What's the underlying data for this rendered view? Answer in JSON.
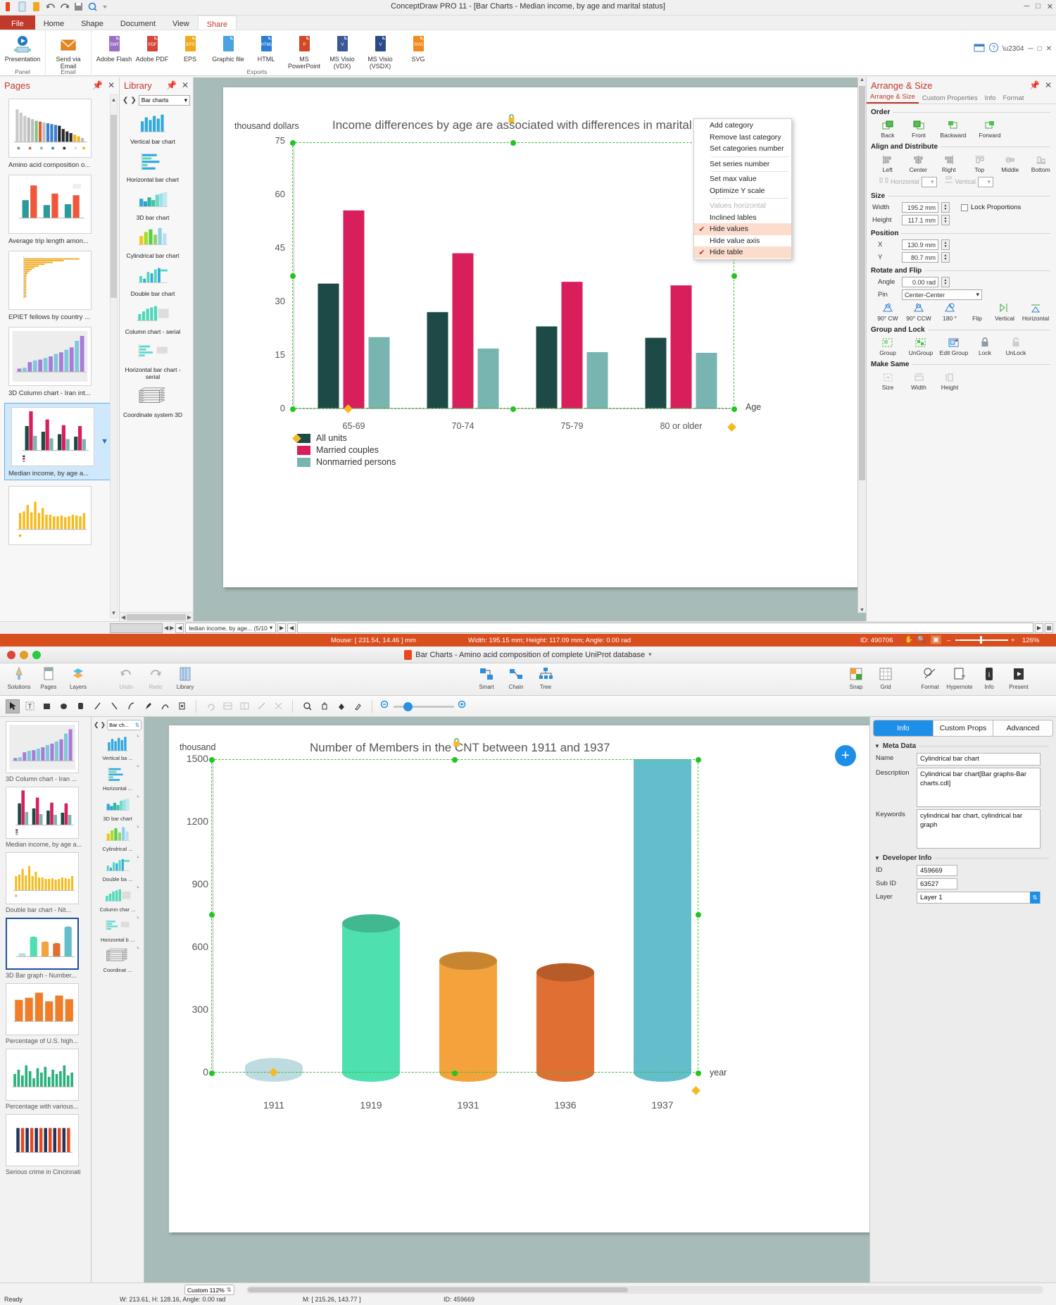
{
  "top_window": {
    "title": "ConceptDraw PRO 11 - [Bar Charts - Median income, by age and marital status]",
    "window_buttons": {
      "minimize": "─",
      "maximize": "□",
      "close": "✕"
    },
    "quick_access": [
      "new-doc-icon",
      "open-icon",
      "save-icon",
      "undo-icon",
      "redo-icon",
      "save2-icon",
      "preview-icon",
      "qat-dropdown-icon"
    ],
    "ribbon_tabs": [
      {
        "label": "File",
        "id": "file"
      },
      {
        "label": "Home",
        "id": "home"
      },
      {
        "label": "Shape",
        "id": "shape"
      },
      {
        "label": "Document",
        "id": "document"
      },
      {
        "label": "View",
        "id": "view"
      },
      {
        "label": "Share",
        "id": "share",
        "active": true
      }
    ],
    "ribbon_groups": [
      {
        "name": "Panel",
        "commands": [
          {
            "label": "Presentation",
            "icon": "presentation-icon",
            "color": "#1f7bbf"
          }
        ]
      },
      {
        "name": "Email",
        "commands": [
          {
            "label": "Send via Email",
            "icon": "email-icon",
            "color": "#e8851f"
          }
        ]
      },
      {
        "name": "Exports",
        "commands": [
          {
            "label": "Adobe Flash",
            "icon": "swf-icon",
            "color": "#9b6fc6"
          },
          {
            "label": "Adobe PDF",
            "icon": "pdf-icon",
            "color": "#d8453c"
          },
          {
            "label": "EPS",
            "icon": "eps-icon",
            "color": "#f0a81e"
          },
          {
            "label": "Graphic file",
            "icon": "image-icon",
            "color": "#4aa3df"
          },
          {
            "label": "HTML",
            "icon": "html-icon",
            "color": "#2a7fd4"
          },
          {
            "label": "MS PowerPoint",
            "icon": "powerpoint-icon",
            "color": "#d24726"
          },
          {
            "label": "MS Visio (VDX)",
            "icon": "visio-vdx-icon",
            "color": "#3b5998"
          },
          {
            "label": "MS Visio (VSDX)",
            "icon": "visio-vsdx-icon",
            "color": "#2b4a8b"
          },
          {
            "label": "SVG",
            "icon": "svg-icon",
            "color": "#f08a1e"
          }
        ]
      }
    ],
    "pages_panel": {
      "title": "Pages",
      "pin_icon": "pin-icon",
      "close_icon": "close-icon",
      "items": [
        {
          "label": "Amino acid composition o...",
          "thumb": "bar-multi"
        },
        {
          "label": "Average trip length amon...",
          "thumb": "double-bar"
        },
        {
          "label": "EPIET fellows by country ...",
          "thumb": "pareto"
        },
        {
          "label": "3D Column chart - Iran int...",
          "thumb": "col3d"
        },
        {
          "label": "Median income, by age a...",
          "thumb": "median",
          "selected": true
        },
        {
          "label": "",
          "thumb": "yellow-bars"
        }
      ]
    },
    "library_panel": {
      "title": "Library",
      "pin_icon": "pin-icon",
      "close_icon": "close-icon",
      "prev_icon": "chevron-left-icon",
      "next_icon": "chevron-right-icon",
      "selected_library": "Bar charts",
      "items": [
        {
          "label": "Vertical bar chart"
        },
        {
          "label": "Horizontal bar chart"
        },
        {
          "label": "3D bar chart"
        },
        {
          "label": "Cylindrical bar chart"
        },
        {
          "label": "Double bar chart"
        },
        {
          "label": "Column chart - serial"
        },
        {
          "label": "Horizontal bar chart - serial"
        },
        {
          "label": "Coordinate system 3D"
        }
      ]
    },
    "context_menu": {
      "items": [
        {
          "label": "Add category",
          "checked": false
        },
        {
          "label": "Remove last category",
          "checked": false
        },
        {
          "label": "Set categories number",
          "checked": false,
          "sep_after": true
        },
        {
          "label": "Set series number",
          "checked": false,
          "sep_after": true
        },
        {
          "label": "Set max value",
          "checked": false
        },
        {
          "label": "Optimize Y scale",
          "checked": false,
          "sep_after": true
        },
        {
          "label": "Values horizontal",
          "checked": false,
          "disabled": true
        },
        {
          "label": "Inclined lables",
          "checked": false
        },
        {
          "label": "Hide values",
          "checked": true,
          "highlight": true
        },
        {
          "label": "Hide value axis",
          "checked": false
        },
        {
          "label": "Hide table",
          "checked": true,
          "highlight": true
        }
      ],
      "check_glyph": "✔"
    },
    "arrange_panel": {
      "title": "Arrange & Size",
      "pin_icon": "pin-icon",
      "close_icon": "close-icon",
      "tabs": [
        {
          "label": "Arrange & Size",
          "active": true
        },
        {
          "label": "Custom Properties"
        },
        {
          "label": "Info"
        },
        {
          "label": "Format"
        }
      ],
      "sections": {
        "order": {
          "title": "Order",
          "buttons": [
            "Back",
            "Front",
            "Backward",
            "Forward"
          ]
        },
        "align": {
          "title": "Align and Distribute",
          "buttons": [
            "Left",
            "Center",
            "Right",
            "Top",
            "Middle",
            "Bottom"
          ],
          "distribute_h": "Horizontal",
          "distribute_v": "Vertical"
        },
        "size": {
          "title": "Size",
          "width_label": "Width",
          "width_value": "195.2 mm",
          "height_label": "Height",
          "height_value": "117.1 mm",
          "lock_proportions": "Lock Proportions"
        },
        "position": {
          "title": "Position",
          "x_label": "X",
          "x_value": "130.9 mm",
          "y_label": "Y",
          "y_value": "80.7 mm"
        },
        "rotate": {
          "title": "Rotate and Flip",
          "angle_label": "Angle",
          "angle_value": "0.00 rad",
          "pin_label": "Pin",
          "pin_value": "Center-Center",
          "buttons": [
            "90° CW",
            "90° CCW",
            "180 °",
            "Flip",
            "Vertical",
            "Horizontal"
          ]
        },
        "group": {
          "title": "Group and Lock",
          "buttons": [
            "Group",
            "UnGroup",
            "Edit Group",
            "Lock",
            "UnLock"
          ]
        },
        "same": {
          "title": "Make Same",
          "buttons": [
            "Size",
            "Width",
            "Height"
          ]
        }
      }
    },
    "doc_tabs": {
      "first_icon": "first-page-icon",
      "prev_icon": "prev-page-icon",
      "active_tab": "ledian income, by age... (5/10",
      "next_icon": "next-page-icon",
      "last_icon": "last-page-icon"
    },
    "status_bar": {
      "mouse": "Mouse: [ 231.54, 14.46 ] mm",
      "dims": "Width: 195.15 mm; Height: 117.09 mm; Angle: 0.00 rad",
      "id": "ID: 490706",
      "pan_icon": "hand-icon",
      "zoom_icon": "zoom-icon",
      "fit_icon": "fit-icon",
      "zoom_minus": "–",
      "zoom_plus": "+",
      "zoom_level": "126%"
    },
    "chart_data": {
      "type": "bar",
      "title": "Income differences by age are associated with differences in marital status",
      "ylabel": "thousand dollars",
      "xlabel": "Age",
      "categories": [
        "65-69",
        "70-74",
        "75-79",
        "80 or older"
      ],
      "yticks": [
        0,
        15,
        30,
        45,
        60,
        75
      ],
      "ylim": [
        0,
        75
      ],
      "grid": false,
      "legend_position": "bottom-left",
      "series": [
        {
          "name": "All units",
          "color": "#1d4a47",
          "values": [
            35.0,
            27.0,
            23.0,
            19.8
          ]
        },
        {
          "name": "Married couples",
          "color": "#d81e5b",
          "values": [
            55.5,
            43.5,
            35.5,
            34.5
          ]
        },
        {
          "name": "Nonmarried persons",
          "color": "#78b4b0",
          "values": [
            20.0,
            16.8,
            15.8,
            15.6
          ]
        }
      ]
    }
  },
  "bottom_window": {
    "title": "Bar Charts - Amino acid composition of complete UniProt database",
    "title_dropdown_icon": "chevron-down-icon",
    "doc_icon": "document-icon",
    "traffic_lights": [
      "close-light",
      "minimize-light",
      "zoom-light"
    ],
    "toolbar_left": [
      {
        "label": "Solutions",
        "icon": "solutions-icon"
      },
      {
        "label": "Pages",
        "icon": "pages-icon"
      },
      {
        "label": "Layers",
        "icon": "layers-icon"
      }
    ],
    "toolbar_left2": [
      {
        "label": "Undo",
        "icon": "undo-icon",
        "disabled": true
      },
      {
        "label": "Redo",
        "icon": "redo-icon",
        "disabled": true
      },
      {
        "label": "Library",
        "icon": "library-icon"
      }
    ],
    "toolbar_center": [
      {
        "label": "Smart",
        "icon": "smart-icon"
      },
      {
        "label": "Chain",
        "icon": "chain-icon"
      },
      {
        "label": "Tree",
        "icon": "tree-icon"
      }
    ],
    "toolbar_right": [
      {
        "label": "Snap",
        "icon": "snap-icon"
      },
      {
        "label": "Grid",
        "icon": "grid-icon"
      }
    ],
    "toolbar_right2": [
      {
        "label": "Format",
        "icon": "format-icon"
      },
      {
        "label": "Hypernote",
        "icon": "hypernote-icon"
      },
      {
        "label": "Info",
        "icon": "info-icon",
        "active": true
      },
      {
        "label": "Present",
        "icon": "present-icon"
      }
    ],
    "tool_palette": [
      "pointer-icon",
      "text-icon",
      "rectangle-icon",
      "ellipse-icon",
      "roundrect-icon",
      "line-icon",
      "diagonal-icon",
      "arc-icon",
      "pen-icon",
      "curve-icon",
      "polyline-icon"
    ],
    "tool_palette2": [
      "rotate-icon",
      "align-icon",
      "distribute-icon",
      "connector-icon",
      "scissors-icon"
    ],
    "tool_palette3": [
      "zoom-icon",
      "hand-icon",
      "fill-icon",
      "eyedropper-icon"
    ],
    "zoom_slider": {
      "out_icon": "zoom-out-icon",
      "in_icon": "zoom-in-icon"
    },
    "pages_panel": {
      "items": [
        {
          "label": "3D Column chart - Iran ...",
          "thumb": "col3d"
        },
        {
          "label": "Median income, by age a...",
          "thumb": "median"
        },
        {
          "label": "Double bar chart - Nit...",
          "thumb": "yellow-bars"
        },
        {
          "label": "3D Bar graph - Number...",
          "thumb": "cyl",
          "selected": true
        },
        {
          "label": "Percentage of U.S. high...",
          "thumb": "orange-bars"
        },
        {
          "label": "Percentage with various...",
          "thumb": "green-bars"
        },
        {
          "label": "Serious crime in Cincinnati",
          "thumb": "crime"
        }
      ]
    },
    "library_panel": {
      "prev_icon": "chevron-left-icon",
      "next_icon": "chevron-right-icon",
      "selected_library": "Bar ch...",
      "items": [
        {
          "label": "Vertical ba ..."
        },
        {
          "label": "Horizontal ..."
        },
        {
          "label": "3D bar chart"
        },
        {
          "label": "Cylindrical ..."
        },
        {
          "label": "Double ba ..."
        },
        {
          "label": "Column char ..."
        },
        {
          "label": "Horizontal b ..."
        },
        {
          "label": "Coordinat ..."
        }
      ]
    },
    "info_panel": {
      "tabs": [
        {
          "label": "Info",
          "active": true
        },
        {
          "label": "Custom Props"
        },
        {
          "label": "Advanced"
        }
      ],
      "meta_section": "Meta Data",
      "fields": [
        {
          "label": "Name",
          "value": "Cylindrical bar chart"
        },
        {
          "label": "Description",
          "value": "Cylindrical bar chart[Bar graphs-Bar charts.cdl]"
        },
        {
          "label": "Keywords",
          "value": "cylindrical bar chart, cylindrical bar graph"
        }
      ],
      "dev_section": "Developer Info",
      "dev_fields": [
        {
          "label": "ID",
          "value": "459669"
        },
        {
          "label": "Sub ID",
          "value": "63527"
        },
        {
          "label": "Layer",
          "value": "Layer 1"
        }
      ],
      "add_button": "+"
    },
    "status_bar": {
      "ready": "Ready",
      "dims": "W: 213.61,  H: 128.16,  Angle: 0.00 rad",
      "mouse": "M: [ 215.26, 143.77 ]",
      "id": "ID: 459669",
      "zoom": "Custom 112%"
    },
    "chart_data": {
      "type": "bar",
      "subtype": "cylindrical-3d",
      "title": "Number of Members in the CNT between 1911 and 1937",
      "ylabel": "thousand",
      "xlabel": "year",
      "categories": [
        "1911",
        "1919",
        "1931",
        "1936",
        "1937"
      ],
      "yticks": [
        0,
        300,
        600,
        900,
        1200,
        1500
      ],
      "ylim": [
        0,
        1500
      ],
      "grid": false,
      "values": [
        26,
        714,
        535,
        480,
        1577
      ],
      "colors": [
        "#bfdbe2",
        "#4fe0b0",
        "#f6a council",
        "#e0702f",
        "#5fbccb"
      ],
      "series_colors": [
        "#bfdbe2",
        "#4fe0b0",
        "#f4a23c",
        "#df6f32",
        "#63bdcb"
      ]
    }
  }
}
